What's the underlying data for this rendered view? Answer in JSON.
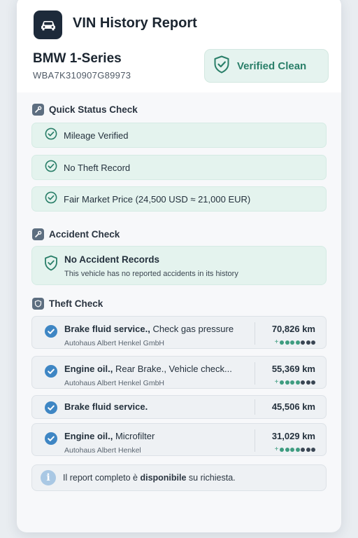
{
  "header": {
    "app_icon": "car-icon",
    "title": "VIN History Report"
  },
  "vehicle": {
    "model": "BMW 1-Series",
    "vin": "WBA7K310907G89973",
    "badge_label": "Verified Clean",
    "badge_icon": "shield-check-icon"
  },
  "quick_status": {
    "title": "Quick Status Check",
    "icon": "wrench-icon",
    "items": [
      {
        "label": "Mileage Verified"
      },
      {
        "label": "No Theft Record"
      },
      {
        "label": "Fair Market Price (24,500 USD ≈ 21,000 EUR)"
      }
    ]
  },
  "accident_check": {
    "title": "Accident Check",
    "icon": "wrench-icon",
    "heading": "No Accident Records",
    "description": "This vehicle has no reported accidents in its history"
  },
  "theft_check": {
    "title": "Theft Check",
    "icon": "shield-icon",
    "records": [
      {
        "service_bold": "Brake fluid service.,",
        "service_rest": " Check gas pressure",
        "shop": "Autohaus Albert Henkel GmbH",
        "km": "70,826 km",
        "has_dots": true
      },
      {
        "service_bold": "Engine oil.,",
        "service_rest": " Rear Brake., Vehicle check...",
        "shop": "Autohaus Albert Henkel GmbH",
        "km": "55,369 km",
        "has_dots": true
      },
      {
        "service_bold": "Brake fluid service.",
        "service_rest": "",
        "shop": "",
        "km": "45,506 km",
        "has_dots": false
      },
      {
        "service_bold": "Engine oil.,",
        "service_rest": " Microfilter",
        "shop": "Autohaus Albert Henkel",
        "km": "31,029 km",
        "has_dots": true
      }
    ]
  },
  "info": {
    "prefix": "Il report completo è ",
    "bold": "disponibile",
    "suffix": " su richiesta."
  },
  "colors": {
    "accent_green": "#2a7f69",
    "check_blue": "#3e86c4",
    "dark_icon_bg": "#1d2a3a"
  }
}
